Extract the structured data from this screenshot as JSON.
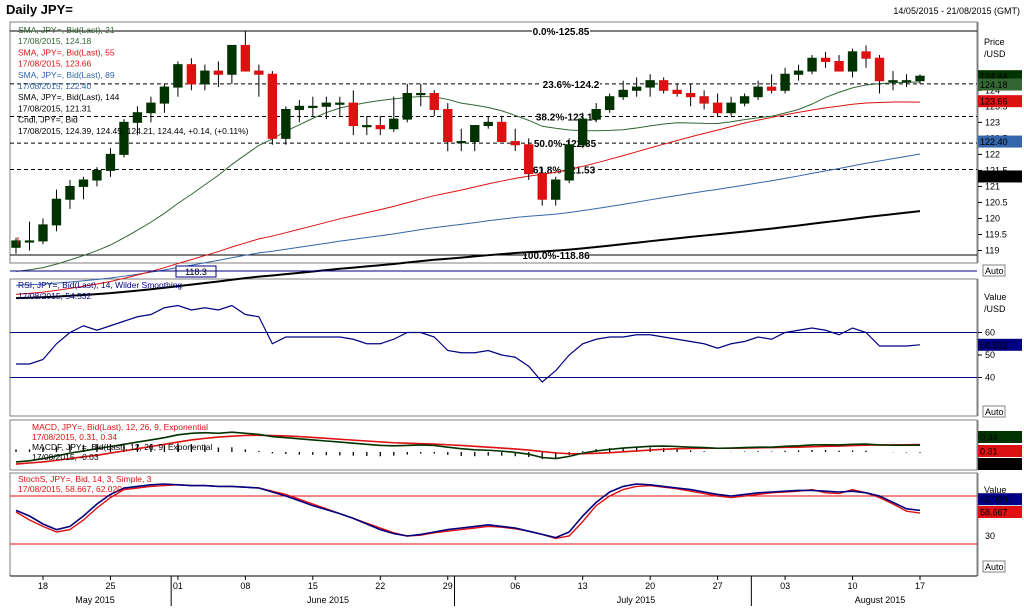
{
  "title": "Daily JPY=",
  "date_range": "14/05/2015 - 21/08/2015 (GMT)",
  "colors": {
    "bull": "#003300",
    "bear": "#dd1111",
    "sma21": "#336633",
    "sma55": "#dd1111",
    "sma89": "#3366aa",
    "sma144": "#000000",
    "rsi": "#000080",
    "macd": "#003300",
    "signal": "#dd1111",
    "stoch_k": "#000080",
    "stoch_d": "#dd1111"
  },
  "price_panel": {
    "legend": [
      "SMA, JPY=, Bid(Last), 21",
      "17/08/2015, 124.18",
      "SMA, JPY=, Bid(Last), 55",
      "17/08/2015, 123.66",
      "SMA, JPY=, Bid(Last), 89",
      "17/08/2015, 122.40",
      "SMA, JPY=, Bid(Last), 144",
      "17/08/2015, 121.31",
      "Cndl, JPY=, Bid",
      "17/08/2015, 124.39, 124.45, 124.21, 124.44, +0.14, (+0.11%)"
    ],
    "axis_title": "Price",
    "axis_unit": "/USD",
    "ticks": [
      "124.5",
      "124",
      "123.5",
      "123",
      "122.5",
      "122",
      "121.5",
      "121",
      "120.5",
      "120",
      "119.5",
      "119"
    ],
    "auto_label": "Auto",
    "tags": [
      {
        "text": "124.44"
      },
      {
        "text": "124.18"
      },
      {
        "text": "123.66"
      },
      {
        "text": "122.40"
      },
      {
        "text": "121.31"
      }
    ],
    "fib_levels": [
      {
        "label": "0.0%-125.85",
        "value": 125.85
      },
      {
        "label": "23.6%-124.2",
        "value": 124.2
      },
      {
        "label": "38.2%-123.18",
        "value": 123.18
      },
      {
        "label": "50.0%-122.35",
        "value": 122.35
      },
      {
        "label": "61.8%-121.53",
        "value": 121.53
      },
      {
        "label": "100.0%-118.86",
        "value": 118.86
      }
    ],
    "low_marker": "118.3"
  },
  "rsi_panel": {
    "legend": [
      "RSI, JPY=, Bid(Last), 14, Wilder Smoothing",
      "17/08/2015, 54.532"
    ],
    "axis_title": "Value",
    "axis_unit": "/USD",
    "ticks": [
      "60",
      "50",
      "40"
    ],
    "tag": "54.532",
    "auto_label": "Auto"
  },
  "macd_panel": {
    "legend": [
      "MACD, JPY=, Bid(Last), 12, 26, 9, Exponential",
      "17/08/2015, 0.31, 0.34",
      "MACDF, JPY=, Bid(Last), 12, 26, 9, Exponential",
      "17/08/2015, -0.03"
    ],
    "tags": [
      "0.34",
      "0.31",
      "-0.03"
    ]
  },
  "stoch_panel": {
    "legend": [
      "StochS, JPY=, Bid, 14, 3, Simple, 3",
      "17/08/2015, 58.667, 62.020"
    ],
    "axis_title": "Value",
    "ticks": [
      "30"
    ],
    "tags": [
      "62.020",
      "58.667"
    ],
    "auto_label": "Auto"
  },
  "x_axis": {
    "day_labels": [
      "18",
      "25",
      "01",
      "08",
      "15",
      "22",
      "29",
      "06",
      "13",
      "20",
      "27",
      "03",
      "10",
      "17"
    ],
    "month_labels": [
      "May 2015",
      "June 2015",
      "July 2015",
      "August 2015"
    ]
  },
  "chart_data": [
    {
      "type": "candlestick",
      "title": "Daily JPY=",
      "dates": [
        "2015-05-14",
        "2015-05-15",
        "2015-05-18",
        "2015-05-19",
        "2015-05-20",
        "2015-05-21",
        "2015-05-22",
        "2015-05-25",
        "2015-05-26",
        "2015-05-27",
        "2015-05-28",
        "2015-05-29",
        "2015-06-01",
        "2015-06-02",
        "2015-06-03",
        "2015-06-04",
        "2015-06-05",
        "2015-06-08",
        "2015-06-09",
        "2015-06-10",
        "2015-06-11",
        "2015-06-12",
        "2015-06-15",
        "2015-06-16",
        "2015-06-17",
        "2015-06-18",
        "2015-06-19",
        "2015-06-22",
        "2015-06-23",
        "2015-06-24",
        "2015-06-25",
        "2015-06-26",
        "2015-06-29",
        "2015-06-30",
        "2015-07-01",
        "2015-07-02",
        "2015-07-03",
        "2015-07-06",
        "2015-07-07",
        "2015-07-08",
        "2015-07-09",
        "2015-07-10",
        "2015-07-13",
        "2015-07-14",
        "2015-07-15",
        "2015-07-16",
        "2015-07-17",
        "2015-07-20",
        "2015-07-21",
        "2015-07-22",
        "2015-07-23",
        "2015-07-24",
        "2015-07-27",
        "2015-07-28",
        "2015-07-29",
        "2015-07-30",
        "2015-07-31",
        "2015-08-03",
        "2015-08-04",
        "2015-08-05",
        "2015-08-06",
        "2015-08-07",
        "2015-08-10",
        "2015-08-11",
        "2015-08-12",
        "2015-08-13",
        "2015-08-14",
        "2015-08-17"
      ],
      "open": [
        119.1,
        119.3,
        119.3,
        119.8,
        120.6,
        121.0,
        121.2,
        121.5,
        122.0,
        123.0,
        123.3,
        123.6,
        124.1,
        124.8,
        124.2,
        124.6,
        124.5,
        125.4,
        124.6,
        124.5,
        122.5,
        123.4,
        123.5,
        123.5,
        123.6,
        123.6,
        122.9,
        122.9,
        122.8,
        123.1,
        123.9,
        123.9,
        123.4,
        122.4,
        122.4,
        122.9,
        123.0,
        122.4,
        122.3,
        121.4,
        120.6,
        121.2,
        122.3,
        123.1,
        123.4,
        123.8,
        124.0,
        124.1,
        124.3,
        124.0,
        123.9,
        123.8,
        123.6,
        123.3,
        123.6,
        123.8,
        124.1,
        124.0,
        124.5,
        124.6,
        125.0,
        124.9,
        124.6,
        125.2,
        125.0,
        124.3,
        124.3,
        124.3
      ],
      "high": [
        119.4,
        119.9,
        120.0,
        120.9,
        121.2,
        121.3,
        121.6,
        122.2,
        123.1,
        123.5,
        123.8,
        124.2,
        124.9,
        125.0,
        124.8,
        124.9,
        125.2,
        125.85,
        124.8,
        124.6,
        123.5,
        123.7,
        123.8,
        123.8,
        123.8,
        124.0,
        123.2,
        123.2,
        123.8,
        124.2,
        124.2,
        124.0,
        123.6,
        122.8,
        122.9,
        123.2,
        123.2,
        122.8,
        122.5,
        121.6,
        121.3,
        122.5,
        123.3,
        123.6,
        123.9,
        124.3,
        124.4,
        124.5,
        124.4,
        124.2,
        124.2,
        124.0,
        123.9,
        123.8,
        123.9,
        124.3,
        124.5,
        124.7,
        124.8,
        125.1,
        125.2,
        125.1,
        125.3,
        125.4,
        125.1,
        124.6,
        124.5,
        124.5
      ],
      "low": [
        118.9,
        119.0,
        119.2,
        119.6,
        120.3,
        120.6,
        121.0,
        121.3,
        121.9,
        122.6,
        123.0,
        123.3,
        123.8,
        124.0,
        124.0,
        124.1,
        124.2,
        124.6,
        123.8,
        122.3,
        122.3,
        123.0,
        123.2,
        123.1,
        123.2,
        122.6,
        122.6,
        122.6,
        122.7,
        123.0,
        123.5,
        123.2,
        122.1,
        122.1,
        122.1,
        122.8,
        122.9,
        122.1,
        121.2,
        120.4,
        120.4,
        121.1,
        122.2,
        123.0,
        123.3,
        123.7,
        123.8,
        123.8,
        123.9,
        123.8,
        123.5,
        123.4,
        123.2,
        123.2,
        123.5,
        123.7,
        123.9,
        123.9,
        124.3,
        124.5,
        124.7,
        124.7,
        124.4,
        124.7,
        123.9,
        124.0,
        124.1,
        124.2
      ],
      "close": [
        119.3,
        119.3,
        119.8,
        120.6,
        121.0,
        121.2,
        121.5,
        122.0,
        123.0,
        123.3,
        123.6,
        124.1,
        124.8,
        124.2,
        124.6,
        124.5,
        125.4,
        124.6,
        124.5,
        122.5,
        123.4,
        123.5,
        123.5,
        123.6,
        123.6,
        122.9,
        122.9,
        122.8,
        123.1,
        123.9,
        123.9,
        123.4,
        122.4,
        122.4,
        122.9,
        123.0,
        122.4,
        122.3,
        121.4,
        120.6,
        121.2,
        122.3,
        123.1,
        123.4,
        123.8,
        124.0,
        124.1,
        124.3,
        124.0,
        123.9,
        123.8,
        123.6,
        123.3,
        123.6,
        123.8,
        124.1,
        124.0,
        124.5,
        124.6,
        125.0,
        124.9,
        124.6,
        125.2,
        125.0,
        124.3,
        124.3,
        124.3,
        124.44
      ],
      "ylim": [
        118.86,
        125.85
      ]
    },
    {
      "type": "line",
      "title": "RSI, JPY=, Bid(Last), 14, Wilder Smoothing",
      "x": [
        "2015-05-14",
        "2015-05-15",
        "2015-05-18",
        "2015-05-19",
        "2015-05-20",
        "2015-05-21",
        "2015-05-22",
        "2015-05-25",
        "2015-05-26",
        "2015-05-27",
        "2015-05-28",
        "2015-05-29",
        "2015-06-01",
        "2015-06-02",
        "2015-06-03",
        "2015-06-04",
        "2015-06-05",
        "2015-06-08",
        "2015-06-09",
        "2015-06-10",
        "2015-06-11",
        "2015-06-12",
        "2015-06-15",
        "2015-06-16",
        "2015-06-17",
        "2015-06-18",
        "2015-06-19",
        "2015-06-22",
        "2015-06-23",
        "2015-06-24",
        "2015-06-25",
        "2015-06-26",
        "2015-06-29",
        "2015-06-30",
        "2015-07-01",
        "2015-07-02",
        "2015-07-03",
        "2015-07-06",
        "2015-07-07",
        "2015-07-08",
        "2015-07-09",
        "2015-07-10",
        "2015-07-13",
        "2015-07-14",
        "2015-07-15",
        "2015-07-16",
        "2015-07-17",
        "2015-07-20",
        "2015-07-21",
        "2015-07-22",
        "2015-07-23",
        "2015-07-24",
        "2015-07-27",
        "2015-07-28",
        "2015-07-29",
        "2015-07-30",
        "2015-07-31",
        "2015-08-03",
        "2015-08-04",
        "2015-08-05",
        "2015-08-06",
        "2015-08-07",
        "2015-08-10",
        "2015-08-11",
        "2015-08-12",
        "2015-08-13",
        "2015-08-14",
        "2015-08-17"
      ],
      "y": [
        46,
        46,
        48,
        55,
        60,
        63,
        61,
        63,
        65,
        67,
        68,
        71,
        72,
        70,
        71,
        70,
        72,
        68,
        67,
        55,
        58,
        58,
        58,
        58,
        58,
        57,
        55,
        55,
        57,
        60,
        60,
        58,
        52,
        51,
        51,
        52,
        50,
        49,
        45,
        38,
        43,
        50,
        55,
        57,
        58,
        58,
        59,
        59,
        58,
        57,
        56,
        55,
        53,
        55,
        56,
        58,
        57,
        60,
        61,
        62,
        61,
        59,
        62,
        60,
        54,
        54,
        54,
        54.532
      ],
      "ylim": [
        30,
        70
      ]
    },
    {
      "type": "line",
      "title": "MACD, JPY=, Bid(Last), 12, 26, 9, Exponential",
      "series": [
        {
          "name": "MACD",
          "values": [
            -0.45,
            -0.4,
            -0.3,
            -0.18,
            -0.05,
            0.05,
            0.15,
            0.25,
            0.35,
            0.45,
            0.55,
            0.65,
            0.78,
            0.85,
            0.88,
            0.85,
            0.9,
            0.85,
            0.8,
            0.7,
            0.65,
            0.6,
            0.55,
            0.5,
            0.45,
            0.4,
            0.35,
            0.3,
            0.28,
            0.3,
            0.32,
            0.3,
            0.22,
            0.15,
            0.1,
            0.08,
            0.04,
            -0.02,
            -0.1,
            -0.25,
            -0.3,
            -0.2,
            -0.05,
            0.05,
            0.12,
            0.18,
            0.22,
            0.26,
            0.27,
            0.25,
            0.22,
            0.2,
            0.17,
            0.18,
            0.2,
            0.22,
            0.22,
            0.26,
            0.28,
            0.32,
            0.33,
            0.32,
            0.35,
            0.36,
            0.32,
            0.31,
            0.31,
            0.31
          ]
        },
        {
          "name": "Signal",
          "values": [
            -0.55,
            -0.5,
            -0.45,
            -0.38,
            -0.3,
            -0.22,
            -0.15,
            -0.05,
            0.05,
            0.15,
            0.25,
            0.35,
            0.45,
            0.55,
            0.62,
            0.68,
            0.72,
            0.75,
            0.76,
            0.75,
            0.73,
            0.7,
            0.66,
            0.62,
            0.58,
            0.54,
            0.5,
            0.46,
            0.42,
            0.4,
            0.38,
            0.36,
            0.33,
            0.3,
            0.26,
            0.22,
            0.18,
            0.14,
            0.09,
            0.02,
            -0.04,
            -0.08,
            -0.08,
            -0.06,
            -0.03,
            0.01,
            0.05,
            0.09,
            0.12,
            0.15,
            0.16,
            0.17,
            0.17,
            0.17,
            0.18,
            0.19,
            0.2,
            0.21,
            0.22,
            0.24,
            0.26,
            0.27,
            0.29,
            0.31,
            0.32,
            0.32,
            0.33,
            0.34
          ]
        }
      ]
    },
    {
      "type": "line",
      "title": "StochS, JPY=, Bid, 14, 3, Simple, 3",
      "series": [
        {
          "name": "%K",
          "values": [
            62,
            55,
            45,
            38,
            42,
            55,
            70,
            82,
            90,
            92,
            94,
            95,
            94,
            93,
            93,
            92,
            92,
            91,
            90,
            85,
            80,
            74,
            68,
            63,
            58,
            52,
            45,
            38,
            33,
            30,
            32,
            35,
            38,
            40,
            42,
            44,
            42,
            40,
            36,
            32,
            28,
            35,
            55,
            72,
            85,
            92,
            95,
            94,
            92,
            90,
            88,
            85,
            82,
            80,
            82,
            84,
            85,
            86,
            87,
            87,
            86,
            85,
            86,
            84,
            80,
            72,
            64,
            62.02
          ]
        },
        {
          "name": "%D",
          "values": [
            60,
            50,
            42,
            35,
            38,
            50,
            65,
            78,
            88,
            90,
            92,
            93,
            94,
            93,
            93,
            92,
            92,
            91,
            90,
            86,
            82,
            76,
            70,
            64,
            58,
            52,
            46,
            40,
            34,
            30,
            31,
            34,
            36,
            38,
            40,
            42,
            41,
            39,
            36,
            32,
            27,
            30,
            48,
            68,
            80,
            88,
            92,
            93,
            91,
            89,
            86,
            83,
            80,
            78,
            80,
            82,
            84,
            85,
            86,
            88,
            84,
            83,
            88,
            84,
            78,
            70,
            61,
            58.667
          ]
        }
      ]
    }
  ]
}
